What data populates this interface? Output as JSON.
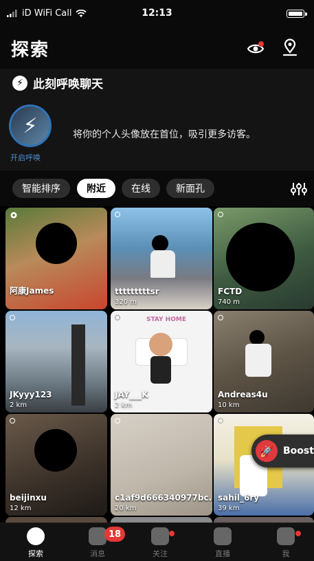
{
  "status_bar": {
    "carrier": "iD WiFi Call",
    "time": "12:13"
  },
  "header": {
    "title": "探索"
  },
  "call_section": {
    "heading": "此刻呼唤聊天",
    "start_label": "开启呼唤",
    "description": "将你的个人头像放在首位，吸引更多访客。"
  },
  "filters": {
    "chips": [
      {
        "label": "智能排序",
        "active": false
      },
      {
        "label": "附近",
        "active": true
      },
      {
        "label": "在线",
        "active": false
      },
      {
        "label": "新面孔",
        "active": false
      }
    ]
  },
  "profiles": [
    {
      "name": "阿康James",
      "distance": ""
    },
    {
      "name": "tttttttttsr",
      "distance": "320 m"
    },
    {
      "name": "FCTD",
      "distance": "740 m"
    },
    {
      "name": "JKyyy123",
      "distance": "2 km"
    },
    {
      "name": "JAY___K",
      "distance": "2 km"
    },
    {
      "name": "Andreas4u",
      "distance": "10 km"
    },
    {
      "name": "beijinxu",
      "distance": "12 km"
    },
    {
      "name": "c1af9d666340977bc...",
      "distance": "20 km"
    },
    {
      "name": "sahil_6ry",
      "distance": "39 km"
    }
  ],
  "stay_home_sticker": "STAY HOME",
  "boost": {
    "label": "Boost"
  },
  "tabbar": {
    "tabs": [
      {
        "label": "探索",
        "icon": "compass-icon"
      },
      {
        "label": "消息",
        "icon": "chat-icon"
      },
      {
        "label": "关注",
        "icon": "feed-icon"
      },
      {
        "label": "直播",
        "icon": "live-icon"
      },
      {
        "label": "我",
        "icon": "profile-icon"
      }
    ],
    "messages_badge": "18"
  },
  "colors": {
    "accent_blue": "#2f72b6",
    "badge_red": "#e53935",
    "boost_red": "#e0393e"
  }
}
